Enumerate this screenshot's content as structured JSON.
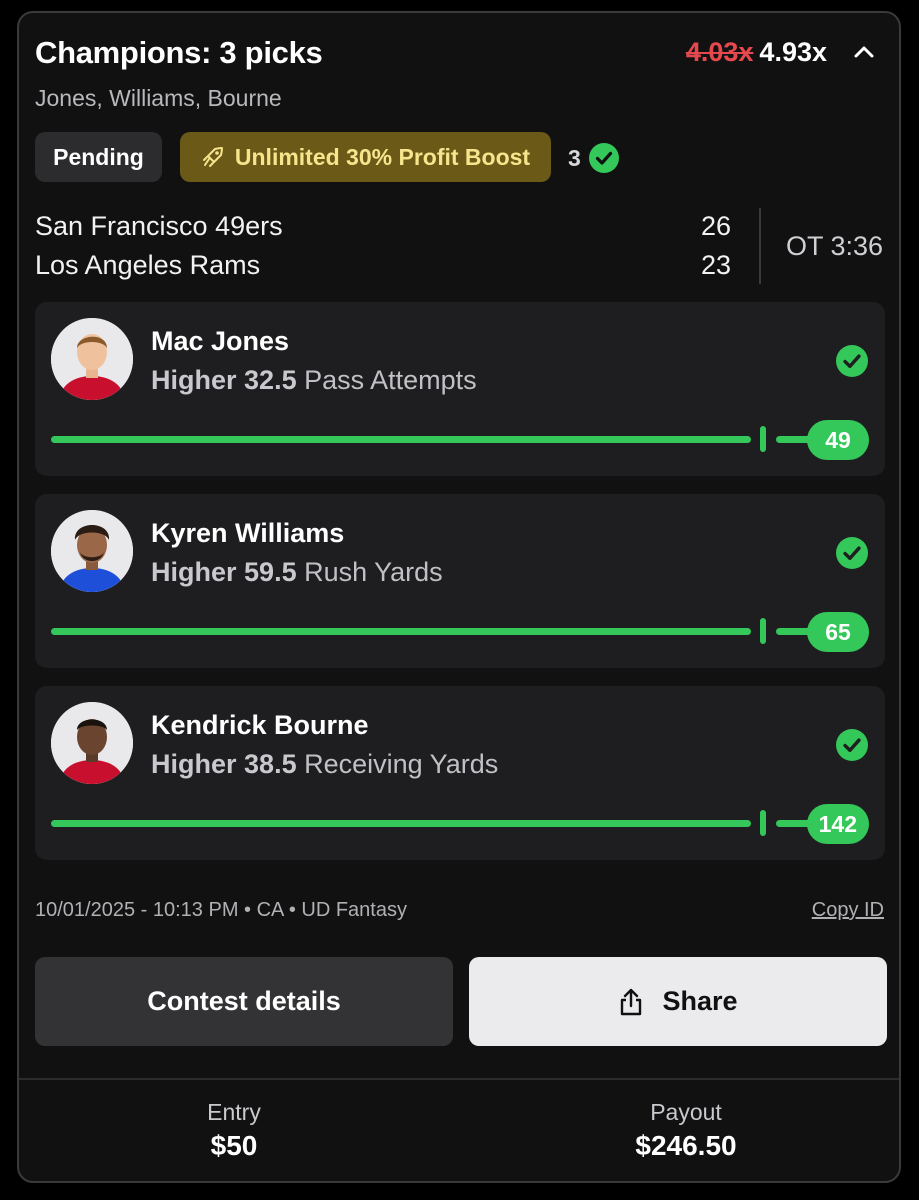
{
  "slip": {
    "title": "Champions: 3 picks",
    "old_multiplier": "4.03x",
    "new_multiplier": "4.93x",
    "players_summary": "Jones, Williams, Bourne",
    "status_badge": "Pending",
    "boost_badge": "Unlimited 30% Profit Boost",
    "correct_count": "3"
  },
  "game": {
    "home_team": "San Francisco 49ers",
    "home_score": "26",
    "away_team": "Los Angeles Rams",
    "away_score": "23",
    "clock": "OT 3:36"
  },
  "picks": [
    {
      "player": "Mac Jones",
      "direction": "Higher",
      "line": "32.5",
      "stat": "Pass Attempts",
      "actual": "49",
      "jersey_color": "#c8102e"
    },
    {
      "player": "Kyren Williams",
      "direction": "Higher",
      "line": "59.5",
      "stat": "Rush Yards",
      "actual": "65",
      "jersey_color": "#1e4fd8"
    },
    {
      "player": "Kendrick Bourne",
      "direction": "Higher",
      "line": "38.5",
      "stat": "Receiving Yards",
      "actual": "142",
      "jersey_color": "#c8102e"
    }
  ],
  "meta": {
    "info": "10/01/2025 - 10:13 PM • CA • UD Fantasy",
    "copy_id": "Copy ID"
  },
  "buttons": {
    "contest_details": "Contest details",
    "share": "Share"
  },
  "footer": {
    "entry_label": "Entry",
    "entry_value": "$50",
    "payout_label": "Payout",
    "payout_value": "$246.50"
  },
  "colors": {
    "success_green": "#34c759",
    "strike_red": "#e5484d",
    "boost_bg": "#6b5917",
    "boost_text": "#f6e58d"
  },
  "icons": {
    "collapse": "chevron-up-icon",
    "boost": "rocket-icon",
    "check": "check-circle-icon",
    "share": "share-icon"
  }
}
